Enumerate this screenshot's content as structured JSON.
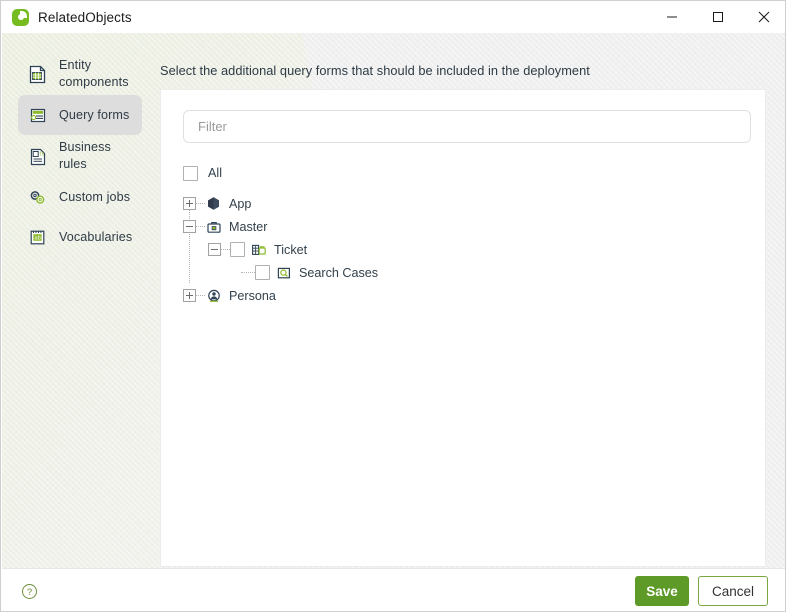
{
  "window": {
    "title": "RelatedObjects",
    "app_icon": "clock-green-icon",
    "controls": {
      "minimize": "minimize-icon",
      "maximize": "maximize-icon",
      "close": "close-icon"
    }
  },
  "sidebar": {
    "items": [
      {
        "label": "Entity components",
        "icon": "entity-components-icon",
        "active": false
      },
      {
        "label": "Query forms",
        "icon": "query-forms-icon",
        "active": true
      },
      {
        "label": "Business rules",
        "icon": "business-rules-icon",
        "active": false
      },
      {
        "label": "Custom jobs",
        "icon": "custom-jobs-icon",
        "active": false
      },
      {
        "label": "Vocabularies",
        "icon": "vocabularies-icon",
        "active": false
      }
    ]
  },
  "main": {
    "instruction": "Select the additional query forms that should be included in the deployment",
    "filter": {
      "value": "",
      "placeholder": "Filter"
    },
    "tree": {
      "select_all_label": "All",
      "select_all_checked": false,
      "nodes": [
        {
          "label": "App",
          "icon": "app-hexagon-icon",
          "expander": "plus",
          "level": 0,
          "checkbox": false
        },
        {
          "label": "Master",
          "icon": "briefcase-icon",
          "expander": "minus",
          "level": 0,
          "checkbox": false
        },
        {
          "label": "Ticket",
          "icon": "entity-table-icon",
          "expander": "minus",
          "level": 1,
          "checkbox": true,
          "checked": false
        },
        {
          "label": "Search Cases",
          "icon": "search-query-icon",
          "expander": "none",
          "level": 2,
          "checkbox": true,
          "checked": false
        },
        {
          "label": "Persona",
          "icon": "persona-icon",
          "expander": "plus",
          "level": 0,
          "checkbox": false
        }
      ]
    }
  },
  "footer": {
    "help_icon": "help-circle-icon",
    "save_label": "Save",
    "cancel_label": "Cancel"
  },
  "colors": {
    "accent_green": "#76bc21",
    "save_green": "#5e9a28",
    "cancel_border": "#7aa83f",
    "text_dark": "#2f3b46",
    "panel_bg": "#ffffff",
    "body_bg": "#f0f0f0"
  }
}
